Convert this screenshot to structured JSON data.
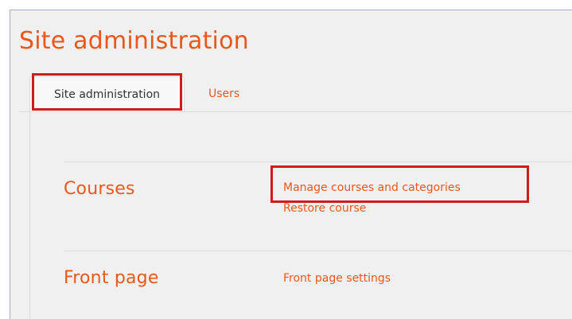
{
  "page": {
    "title": "Site administration"
  },
  "tabs": [
    {
      "label": "Site administration",
      "active": true
    },
    {
      "label": "Users",
      "active": false
    }
  ],
  "sections": [
    {
      "heading": "Courses",
      "links": [
        {
          "label": "Manage courses and categories",
          "highlighted": true
        },
        {
          "label": "Restore course",
          "highlighted": false
        }
      ]
    },
    {
      "heading": "Front page",
      "links": [
        {
          "label": "Front page settings",
          "highlighted": false
        }
      ]
    }
  ],
  "colors": {
    "accent": "#e8581c",
    "highlight_box": "#d11a1a",
    "background": "#f0f0f0",
    "text": "#333333"
  }
}
